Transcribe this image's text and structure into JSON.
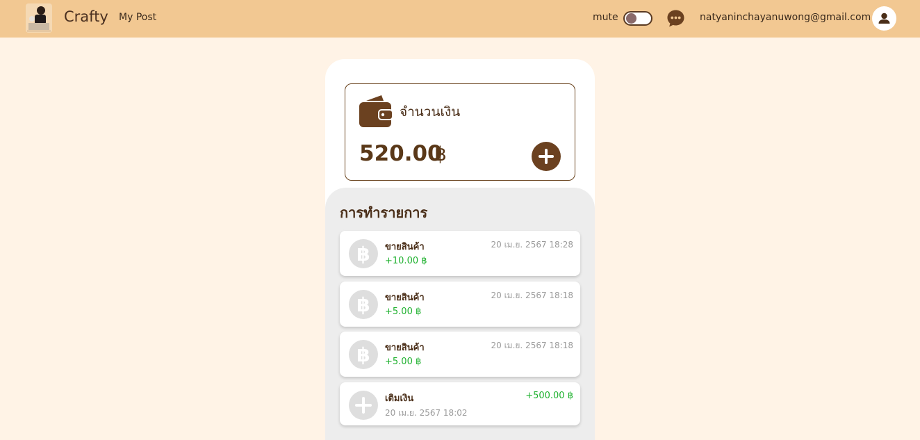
{
  "header": {
    "app_title": "Crafty",
    "nav_mypost": "My Post",
    "mute_label": "mute",
    "user_email": "natyaninchayanuwong@gmail.com",
    "mute_on": false
  },
  "wallet": {
    "label": "จำนวนเงิน",
    "balance": "520.00",
    "unit": "฿"
  },
  "transactions": {
    "title": "การทำรายการ",
    "items": [
      {
        "name": "ขายสินค้า",
        "amount": "+10.00 ฿",
        "date": "20 เม.ย. 2567 18:28",
        "icon": "baht-icon"
      },
      {
        "name": "ขายสินค้า",
        "amount": "+5.00 ฿",
        "date": "20 เม.ย. 2567 18:18",
        "icon": "baht-icon"
      },
      {
        "name": "ขายสินค้า",
        "amount": "+5.00 ฿",
        "date": "20 เม.ย. 2567 18:18",
        "icon": "baht-icon"
      },
      {
        "name": "เติมเงิน",
        "amount": "+500.00 ฿",
        "date": "20 เม.ย. 2567 18:02",
        "icon": "plus-icon"
      }
    ]
  },
  "colors": {
    "header_bg": "#f2c892",
    "page_bg": "#fff3e6",
    "brown": "#6b4120",
    "positive": "#1fb12f"
  }
}
